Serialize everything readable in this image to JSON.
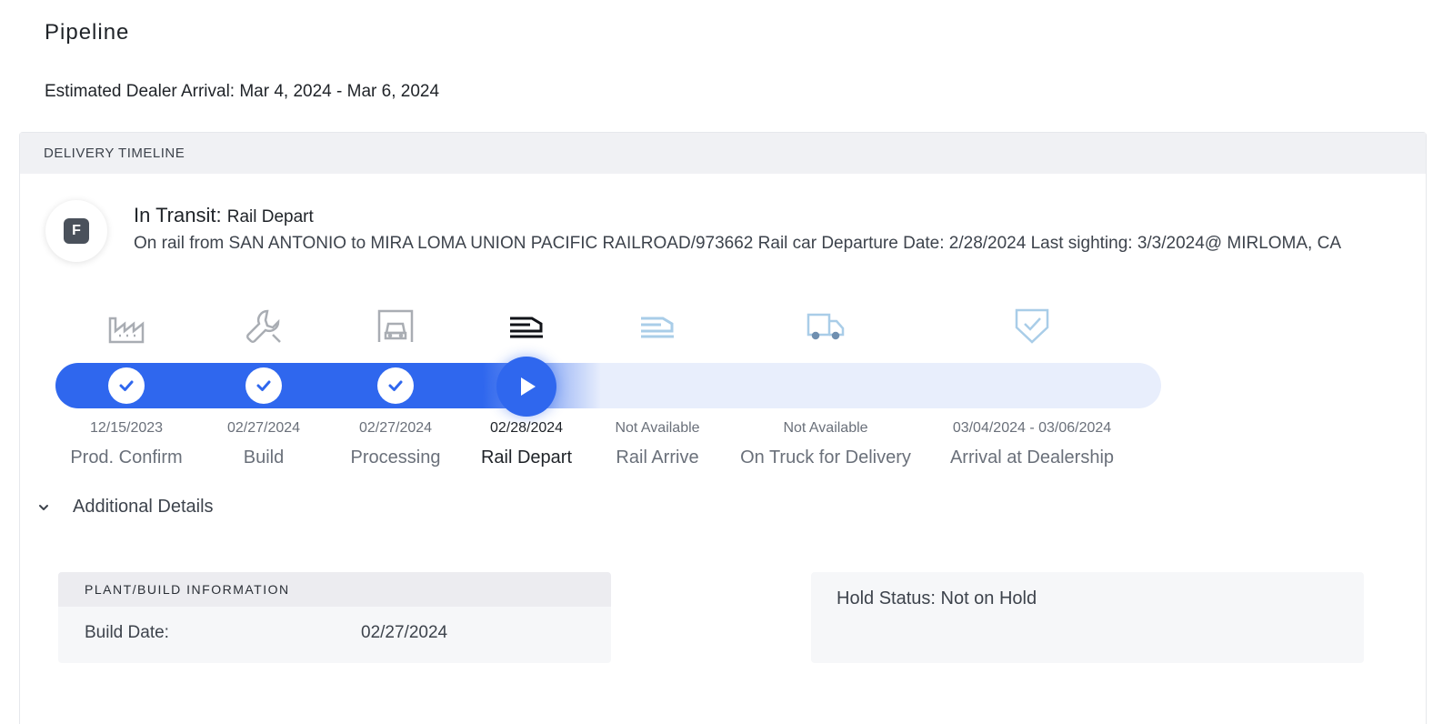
{
  "page": {
    "title": "Pipeline",
    "eta_text": "Estimated Dealer Arrival: Mar 4, 2024 - Mar 6, 2024"
  },
  "timeline": {
    "header": "DELIVERY TIMELINE",
    "status_badge": "F",
    "status_title": "In Transit:",
    "status_subtitle": "Rail Depart",
    "status_description": "On rail from SAN ANTONIO to MIRA LOMA UNION PACIFIC RAILROAD/973662 Rail car Departure Date: 2/28/2024 Last sighting: 3/3/2024@ MIRLOMA, CA",
    "progress_color": "#2f67ee",
    "stages": [
      {
        "label": "Prod. Confirm",
        "date": "12/15/2023",
        "state": "complete",
        "icon": "factory-icon"
      },
      {
        "label": "Build",
        "date": "02/27/2024",
        "state": "complete",
        "icon": "wrench-icon"
      },
      {
        "label": "Processing",
        "date": "02/27/2024",
        "state": "complete",
        "icon": "garage-car-icon"
      },
      {
        "label": "Rail Depart",
        "date": "02/28/2024",
        "state": "current",
        "icon": "train-depart-icon"
      },
      {
        "label": "Rail Arrive",
        "date": "Not Available",
        "state": "pending",
        "icon": "train-arrive-icon"
      },
      {
        "label": "On Truck for Delivery",
        "date": "Not Available",
        "state": "pending",
        "icon": "truck-icon"
      },
      {
        "label": "Arrival at Dealership",
        "date": "03/04/2024 - 03/06/2024",
        "state": "pending",
        "icon": "shield-check-icon"
      }
    ]
  },
  "details": {
    "toggle_label": "Additional Details",
    "plant": {
      "header": "PLANT/BUILD INFORMATION",
      "build_date_label": "Build Date:",
      "build_date_value": "02/27/2024"
    },
    "hold_status": "Hold Status: Not on Hold"
  }
}
